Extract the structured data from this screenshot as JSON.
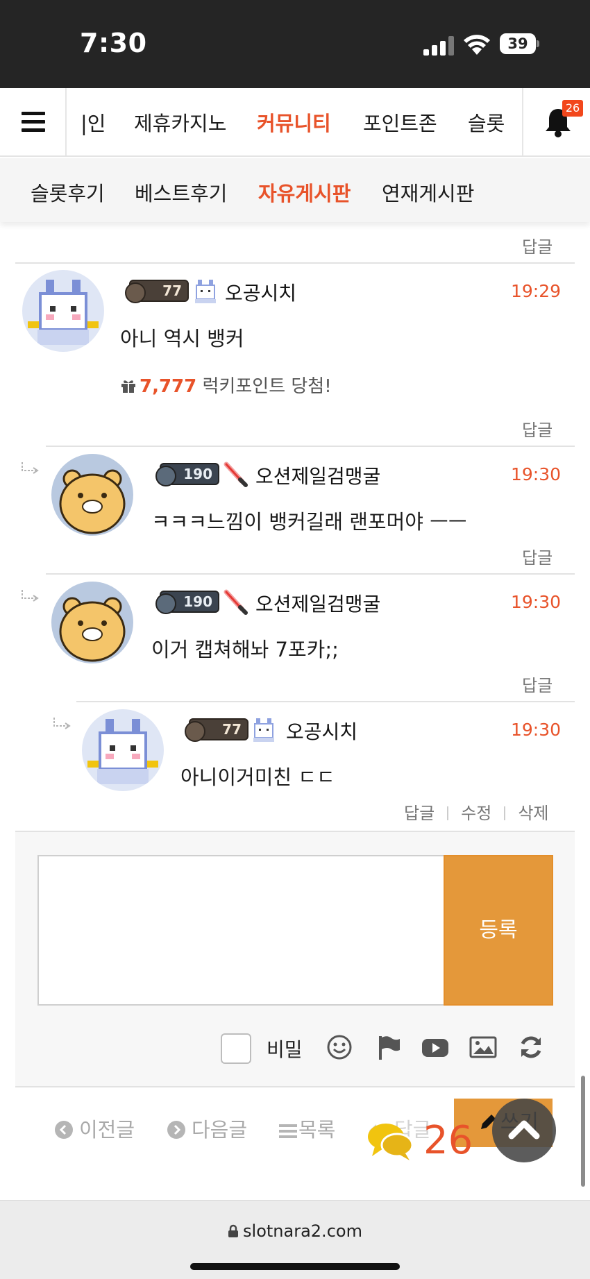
{
  "status_bar": {
    "time": "7:30",
    "battery": "39"
  },
  "top_nav": {
    "items": [
      "|인",
      "제휴카지노",
      "커뮤니티",
      "포인트존",
      "슬롯"
    ],
    "active_index": 2,
    "notification_count": "26"
  },
  "sub_nav": {
    "items": [
      "슬롯후기",
      "베스트후기",
      "자유게시판",
      "연재게시판"
    ],
    "active_index": 2
  },
  "top_reply_label": "답글",
  "comments": [
    {
      "level": "77",
      "nickname": "오공시치",
      "time": "19:29",
      "text": "아니 역시 뱅커",
      "lucky_points": "7,777",
      "lucky_suffix": " 럭키포인트 당첨!",
      "reply_label": "답글"
    },
    {
      "level": "190",
      "nickname": "오션제일검맹굴",
      "time": "19:30",
      "text": "ㅋㅋㅋ느낌이 뱅커길래 랜포머야 ㅡㅡ",
      "reply_label": "답글"
    },
    {
      "level": "190",
      "nickname": "오션제일검맹굴",
      "time": "19:30",
      "text": "이거 캡쳐해놔 7포카;;",
      "reply_label": "답글"
    },
    {
      "level": "77",
      "nickname": "오공시치",
      "time": "19:30",
      "text": "아니이거미친 ㄷㄷ",
      "actions": [
        "답글",
        "수정",
        "삭제"
      ]
    }
  ],
  "compose": {
    "submit_label": "등록",
    "secret_label": "비밀",
    "textarea_value": ""
  },
  "tools": [
    "smiley-icon",
    "flag-icon",
    "youtube-icon",
    "image-icon",
    "refresh-icon"
  ],
  "bottom_nav": {
    "prev_label": "이전글",
    "next_label": "다음글",
    "list_label": "목록",
    "reply_label": "답글",
    "write_label": "쓰기",
    "comment_count": "26"
  },
  "browser": {
    "url": "slotnara2.com"
  },
  "colors": {
    "accent": "#e8532a",
    "button": "#e4983a",
    "status_bar": "#252525"
  }
}
